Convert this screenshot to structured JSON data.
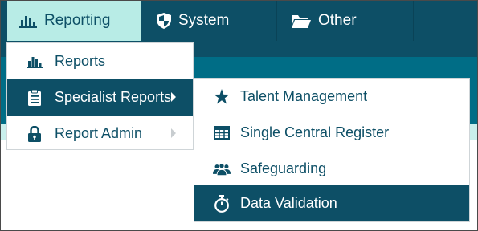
{
  "nav": {
    "tabs": [
      {
        "label": "Reporting",
        "icon": "bar-chart-icon",
        "active": true
      },
      {
        "label": "System",
        "icon": "shield-icon",
        "active": false
      },
      {
        "label": "Other",
        "icon": "folder-open-icon",
        "active": false
      }
    ]
  },
  "reporting_menu": {
    "items": [
      {
        "label": "Reports",
        "icon": "bar-chart-icon"
      },
      {
        "label": "Specialist Reports",
        "icon": "clipboard-icon",
        "has_submenu": true,
        "active": true
      },
      {
        "label": "Report Admin",
        "icon": "lock-icon",
        "has_submenu": true
      }
    ]
  },
  "specialist_submenu": {
    "items": [
      {
        "label": "Talent Management",
        "icon": "star-icon"
      },
      {
        "label": "Single Central Register",
        "icon": "table-icon"
      },
      {
        "label": "Safeguarding",
        "icon": "users-icon"
      },
      {
        "label": "Data Validation",
        "icon": "stopwatch-icon",
        "active": true
      }
    ]
  },
  "colors": {
    "nav_background": "#0d4f66",
    "active_tab": "#b8ece6",
    "menu_highlight": "#0d4f66",
    "text_dark": "#0d4f66",
    "band_teal": "#006d86",
    "band_light": "#c9efec"
  }
}
